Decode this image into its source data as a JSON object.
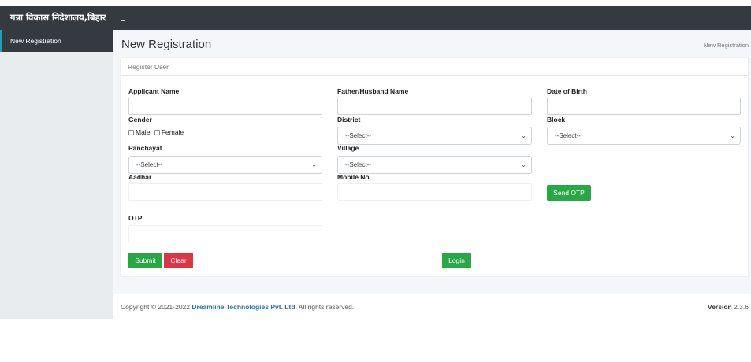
{
  "header": {
    "brand": "गन्ना विकास निदेशालय,बिहार",
    "toggle_icon": "▯"
  },
  "sidebar": {
    "items": [
      {
        "label": "New Registration"
      }
    ]
  },
  "page": {
    "title": "New Registration",
    "breadcrumb": "New Registration"
  },
  "card": {
    "title": "Register User"
  },
  "form": {
    "applicant_name": {
      "label": "Applicant Name",
      "value": ""
    },
    "father_name": {
      "label": "Father/Husband Name",
      "value": ""
    },
    "dob": {
      "label": "Date of Birth",
      "value": ""
    },
    "gender": {
      "label": "Gender",
      "options": [
        "Male",
        "Female"
      ]
    },
    "district": {
      "label": "District",
      "selected": "--Select--"
    },
    "block": {
      "label": "Block",
      "selected": "--Select--"
    },
    "panchayat": {
      "label": "Panchayat",
      "selected": "--Select--"
    },
    "village": {
      "label": "Village",
      "selected": "--Select--"
    },
    "aadhar": {
      "label": "Aadhar",
      "value": ""
    },
    "mobile": {
      "label": "Mobile No",
      "value": ""
    },
    "otp": {
      "label": "OTP",
      "value": ""
    },
    "buttons": {
      "send_otp": "Send OTP",
      "submit": "Submit",
      "clear": "Clear",
      "login": "Login"
    }
  },
  "footer": {
    "copyright_prefix": "Copyright © 2021-2022 ",
    "company": "Dreamline Technologies Pvt. Ltd.",
    "copyright_suffix": " All rights reserved.",
    "version_label": "Version",
    "version": "2.3.6"
  },
  "colors": {
    "navbar": "#343a40",
    "primary_green": "#28a745",
    "danger_red": "#dc3545",
    "link_blue": "#2a6fb0"
  }
}
